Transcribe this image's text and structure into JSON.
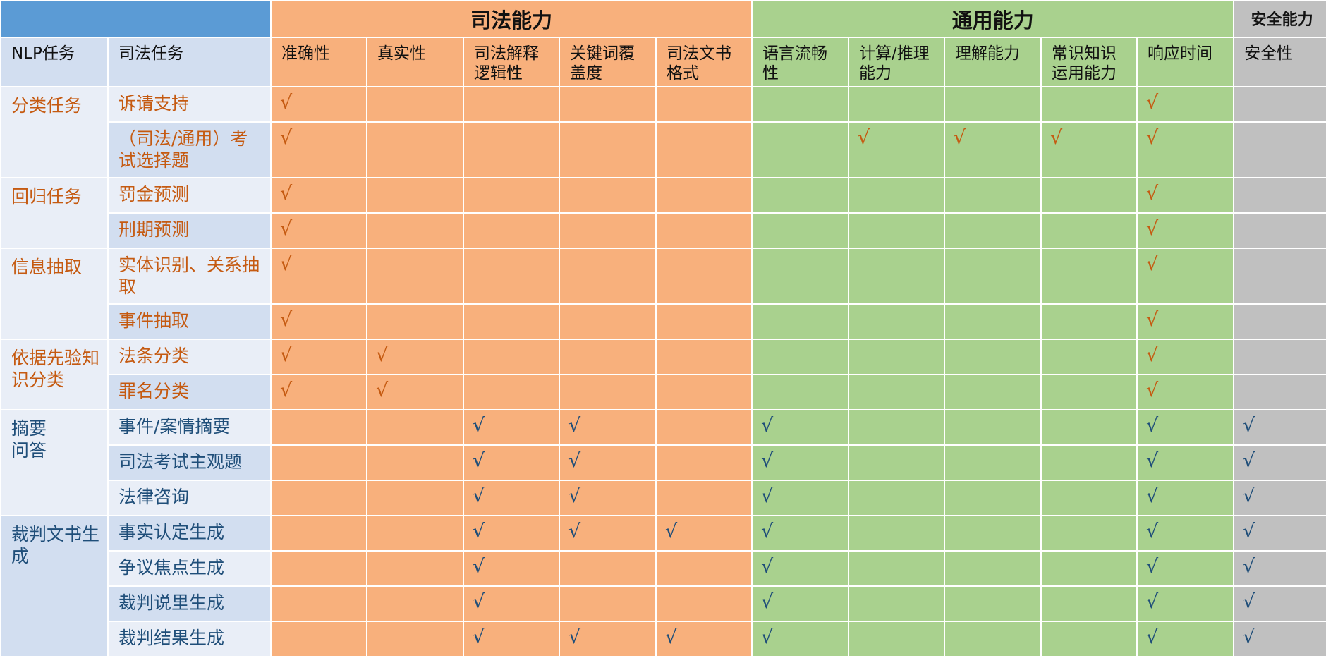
{
  "groups": {
    "judicial": "司法能力",
    "general": "通用能力",
    "safety": "安全能力"
  },
  "header": {
    "nlp_task": "NLP任务",
    "judicial_task": "司法任务",
    "cols": [
      "准确性",
      "真实性",
      "司法解释\n逻辑性",
      "关键词覆\n盖度",
      "司法文书\n格式",
      "语言流畅\n性",
      "计算/推理\n能力",
      "理解能力",
      "常识知识\n运用能力",
      "响应时间",
      "安全性"
    ]
  },
  "check_mark": "√",
  "colors": {
    "blue_header": "#5b9bd5",
    "judicial": "#f8b07c",
    "general": "#a9d18e",
    "safety": "#c0c0c0",
    "text_orange": "#c55a11",
    "text_blue": "#1f4e79",
    "row_light": "#e9eef7",
    "row_dark": "#d2def0"
  },
  "nlp_groups": [
    {
      "label": "分类任务",
      "color": "orange",
      "rows": [
        {
          "task": "诉请支持",
          "marks": [
            1,
            0,
            0,
            0,
            0,
            0,
            0,
            0,
            0,
            1,
            0
          ]
        },
        {
          "task": "（司法/通用）考试选择题",
          "marks": [
            1,
            0,
            0,
            0,
            0,
            0,
            1,
            1,
            1,
            1,
            0
          ]
        }
      ]
    },
    {
      "label": "回归任务",
      "color": "orange",
      "rows": [
        {
          "task": "罚金预测",
          "marks": [
            1,
            0,
            0,
            0,
            0,
            0,
            0,
            0,
            0,
            1,
            0
          ]
        },
        {
          "task": "刑期预测",
          "marks": [
            1,
            0,
            0,
            0,
            0,
            0,
            0,
            0,
            0,
            1,
            0
          ]
        }
      ]
    },
    {
      "label": "信息抽取",
      "color": "orange",
      "rows": [
        {
          "task": "实体识别、关系抽取",
          "marks": [
            1,
            0,
            0,
            0,
            0,
            0,
            0,
            0,
            0,
            1,
            0
          ]
        },
        {
          "task": "事件抽取",
          "marks": [
            1,
            0,
            0,
            0,
            0,
            0,
            0,
            0,
            0,
            1,
            0
          ]
        }
      ]
    },
    {
      "label": "依据先验知识分类",
      "color": "orange",
      "rows": [
        {
          "task": "法条分类",
          "marks": [
            1,
            1,
            0,
            0,
            0,
            0,
            0,
            0,
            0,
            1,
            0
          ]
        },
        {
          "task": "罪名分类",
          "marks": [
            1,
            1,
            0,
            0,
            0,
            0,
            0,
            0,
            0,
            1,
            0
          ]
        }
      ]
    },
    {
      "label": "摘要\n问答",
      "color": "blue",
      "rows": [
        {
          "task": "事件/案情摘要",
          "marks": [
            0,
            0,
            1,
            1,
            0,
            1,
            0,
            0,
            0,
            1,
            1
          ]
        },
        {
          "task": "司法考试主观题",
          "marks": [
            0,
            0,
            1,
            1,
            0,
            1,
            0,
            0,
            0,
            1,
            1
          ]
        },
        {
          "task": "法律咨询",
          "marks": [
            0,
            0,
            1,
            1,
            0,
            1,
            0,
            0,
            0,
            1,
            1
          ]
        }
      ]
    },
    {
      "label": "裁判文书生成",
      "color": "blue",
      "rows": [
        {
          "task": "事实认定生成",
          "marks": [
            0,
            0,
            1,
            1,
            1,
            1,
            0,
            0,
            0,
            1,
            1
          ]
        },
        {
          "task": "争议焦点生成",
          "marks": [
            0,
            0,
            1,
            0,
            0,
            1,
            0,
            0,
            0,
            1,
            1
          ]
        },
        {
          "task": "裁判说里生成",
          "marks": [
            0,
            0,
            1,
            0,
            0,
            1,
            0,
            0,
            0,
            1,
            1
          ]
        },
        {
          "task": "裁判结果生成",
          "marks": [
            0,
            0,
            1,
            1,
            1,
            1,
            0,
            0,
            0,
            1,
            1
          ]
        }
      ]
    }
  ]
}
